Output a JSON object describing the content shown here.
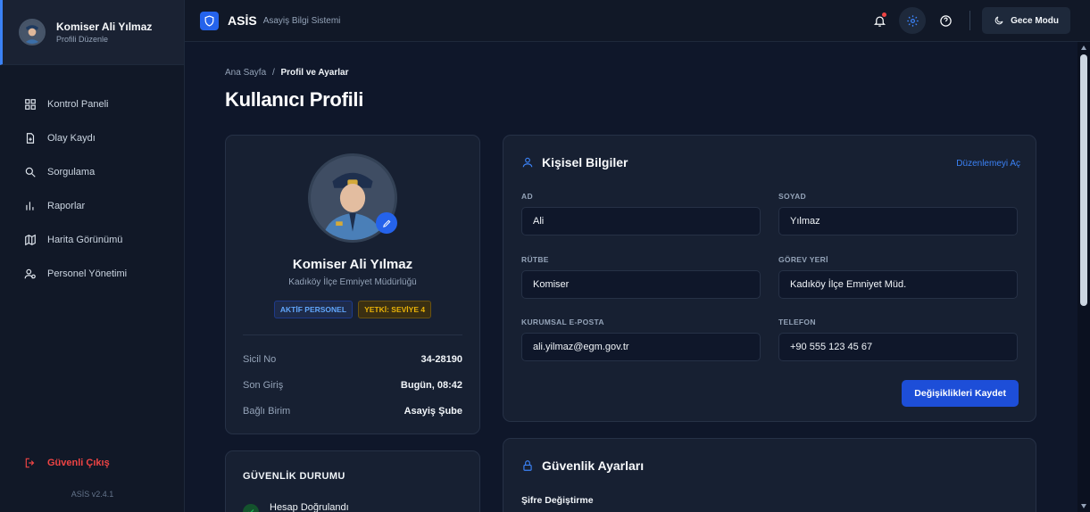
{
  "sidebar": {
    "user_name": "Komiser Ali Yılmaz",
    "user_sub": "Profili Düzenle",
    "items": [
      {
        "label": "Kontrol Paneli",
        "icon": "dashboard-icon"
      },
      {
        "label": "Olay Kaydı",
        "icon": "file-plus-icon"
      },
      {
        "label": "Sorgulama",
        "icon": "search-icon"
      },
      {
        "label": "Raporlar",
        "icon": "bar-chart-icon"
      },
      {
        "label": "Harita Görünümü",
        "icon": "map-icon"
      },
      {
        "label": "Personel Yönetimi",
        "icon": "users-icon"
      }
    ],
    "logout_label": "Güvenli Çıkış",
    "version": "ASİS v2.4.1"
  },
  "header": {
    "brand": "ASİS",
    "brand_sub": "Asayiş Bilgi Sistemi",
    "night_mode_label": "Gece Modu"
  },
  "breadcrumb": {
    "home": "Ana Sayfa",
    "separator": "/",
    "current": "Profil ve Ayarlar"
  },
  "page_title": "Kullanıcı Profili",
  "profile": {
    "name": "Komiser Ali Yılmaz",
    "unit": "Kadıköy İlçe Emniyet Müdürlüğü",
    "badges": [
      "AKTİF PERSONEL",
      "YETKİ: SEVİYE 4"
    ],
    "info": [
      {
        "key": "Sicil No",
        "value": "34-28190"
      },
      {
        "key": "Son Giriş",
        "value": "Bugün, 08:42"
      },
      {
        "key": "Bağlı Birim",
        "value": "Asayiş Şube"
      }
    ]
  },
  "personal": {
    "title": "Kişisel Bilgiler",
    "edit_link": "Düzenlemeyi Aç",
    "fields": {
      "ad_label": "AD",
      "ad_value": "Ali",
      "soyad_label": "SOYAD",
      "soyad_value": "Yılmaz",
      "rutbe_label": "RÜTBE",
      "rutbe_value": "Komiser",
      "gorev_label": "GÖREV YERİ",
      "gorev_value": "Kadıköy İlçe Emniyet Müd.",
      "eposta_label": "KURUMSAL E-POSTA",
      "eposta_value": "ali.yilmaz@egm.gov.tr",
      "telefon_label": "TELEFON",
      "telefon_value": "+90 555 123 45 67"
    },
    "save_label": "Değişiklikleri Kaydet"
  },
  "security_status": {
    "title": "GÜVENLİK DURUMU",
    "verified_label": "Hesap Doğrulandı"
  },
  "security_settings": {
    "title": "Güvenlik Ayarları",
    "password_change": "Şifre Değiştirme"
  },
  "colors": {
    "accent": "#2563eb",
    "danger": "#ef4444",
    "warning": "#eab308",
    "success": "#22c55e"
  }
}
